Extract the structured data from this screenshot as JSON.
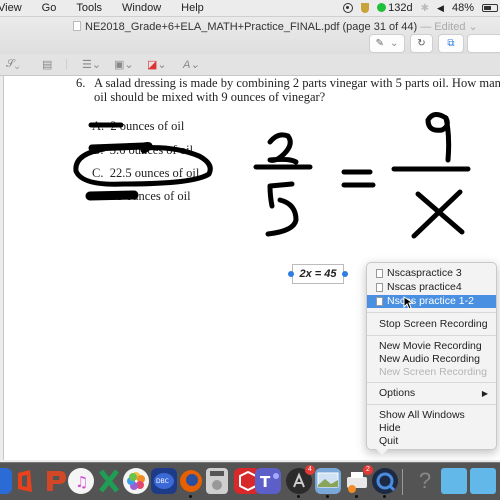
{
  "menubar": {
    "items": [
      "View",
      "Go",
      "Tools",
      "Window",
      "Help"
    ],
    "status": {
      "timer": "132d",
      "battery": "48%"
    }
  },
  "window": {
    "title": "NE2018_Grade+6+ELA_MATH+Practice_FINAL.pdf (page 31 of 44)",
    "edited_label": "— Edited",
    "toolbar": {
      "pen_icon": "pen-icon",
      "rotate_icon": "rotate-icon",
      "toolbox_icon": "toolbox-icon"
    }
  },
  "markup_toolbar": {
    "icons": [
      "signature-icon",
      "text-box-icon",
      "line-style-icon",
      "border-color-icon",
      "fill-color-icon",
      "font-icon"
    ]
  },
  "document": {
    "question_number": "6.",
    "question_line1": "A salad dressing is made by combining 2 parts vinegar with 5 parts oil. How many ounces of",
    "question_line2": "oil should be mixed with 9 ounces of vinegar?",
    "options": [
      {
        "letter": "A.",
        "text": "2 ounces of oil"
      },
      {
        "letter": "B.",
        "text": "3.6 ounces of oil"
      },
      {
        "letter": "C.",
        "text": "22.5 ounces of oil"
      },
      {
        "letter": "D.",
        "text": "45 ounces of oil"
      }
    ],
    "handwriting": {
      "left_numerator": "2",
      "left_denominator": "5",
      "equals": "=",
      "right_numerator": "9",
      "right_denominator": "x"
    },
    "text_annotation": "2x = 45"
  },
  "context_menu": {
    "recent_files": [
      "Nscaspractice 3",
      "Nscas practice4",
      "Nscas practice 1-2"
    ],
    "selected_index": 2,
    "stop_recording": "Stop Screen Recording",
    "new_items": [
      "New Movie Recording",
      "New Audio Recording",
      "New Screen Recording"
    ],
    "disabled_item": "New Screen Recording",
    "options": "Options",
    "window_items": [
      "Show All Windows",
      "Hide",
      "Quit"
    ]
  },
  "dock": {
    "apps": [
      {
        "name": "office-icon",
        "color": "#e8411c"
      },
      {
        "name": "powerpoint-icon",
        "color": "#d24726"
      },
      {
        "name": "itunes-icon",
        "color": "#f2f2f2"
      },
      {
        "name": "excel-x-icon",
        "color": "#1f9d55"
      },
      {
        "name": "photos-icon",
        "color": "#f4f4f4"
      },
      {
        "name": "dbc-icon",
        "color": "#1e3b8a"
      },
      {
        "name": "firefox-icon",
        "color": "#e66000"
      },
      {
        "name": "dvd-player-icon",
        "color": "#cfcfcf"
      },
      {
        "name": "sketchup-icon",
        "color": "#d8282a"
      },
      {
        "name": "teams-icon",
        "color": "#5b5fc7"
      },
      {
        "name": "app-store-icon",
        "color": "#2b2b2b",
        "badge": "4"
      },
      {
        "name": "preview-icon",
        "color": "#7aa8d8"
      },
      {
        "name": "printer-icon",
        "color": "#e8e8e8",
        "badge": "2"
      },
      {
        "name": "quicktime-icon",
        "color": "#1d2a44"
      },
      {
        "name": "help-icon",
        "color": "#5a5a5a"
      },
      {
        "name": "documents-folder-icon",
        "color": "#63b8ea"
      },
      {
        "name": "applications-folder-icon",
        "color": "#63b8ea"
      }
    ]
  }
}
